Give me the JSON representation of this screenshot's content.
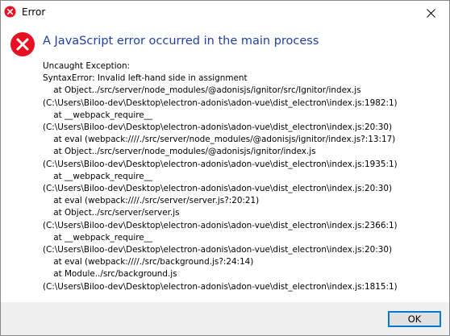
{
  "window": {
    "title": "Error",
    "close_icon": "close-icon",
    "title_icon": "error-icon"
  },
  "dialog": {
    "icon": "error-icon",
    "heading": "A JavaScript error occurred in the main process",
    "message_lines": [
      "Uncaught Exception:",
      "SyntaxError: Invalid left-hand side in assignment",
      "    at Object../src/server/node_modules/@adonisjs/ignitor/src/Ignitor/index.js",
      "(C:\\Users\\Biloo-dev\\Desktop\\electron-adonis\\adon-vue\\dist_electron\\index.js:1982:1)",
      "    at __webpack_require__",
      "(C:\\Users\\Biloo-dev\\Desktop\\electron-adonis\\adon-vue\\dist_electron\\index.js:20:30)",
      "    at eval (webpack:////./src/server/node_modules/@adonisjs/ignitor/index.js?:13:17)",
      "    at Object../src/server/node_modules/@adonisjs/ignitor/index.js",
      "(C:\\Users\\Biloo-dev\\Desktop\\electron-adonis\\adon-vue\\dist_electron\\index.js:1935:1)",
      "    at __webpack_require__",
      "(C:\\Users\\Biloo-dev\\Desktop\\electron-adonis\\adon-vue\\dist_electron\\index.js:20:30)",
      "    at eval (webpack:////./src/server/server.js?:20:21)",
      "    at Object../src/server/server.js",
      "(C:\\Users\\Biloo-dev\\Desktop\\electron-adonis\\adon-vue\\dist_electron\\index.js:2366:1)",
      "    at __webpack_require__",
      "(C:\\Users\\Biloo-dev\\Desktop\\electron-adonis\\adon-vue\\dist_electron\\index.js:20:30)",
      "    at eval (webpack:////./src/background.js?:24:14)",
      "    at Module../src/background.js",
      "(C:\\Users\\Biloo-dev\\Desktop\\electron-adonis\\adon-vue\\dist_electron\\index.js:1815:1)"
    ],
    "ok_label": "OK"
  },
  "colors": {
    "heading": "#1f3fa6",
    "error_red": "#e81123",
    "button_border": "#0078d7",
    "footer_bg": "#f0f0f0"
  }
}
